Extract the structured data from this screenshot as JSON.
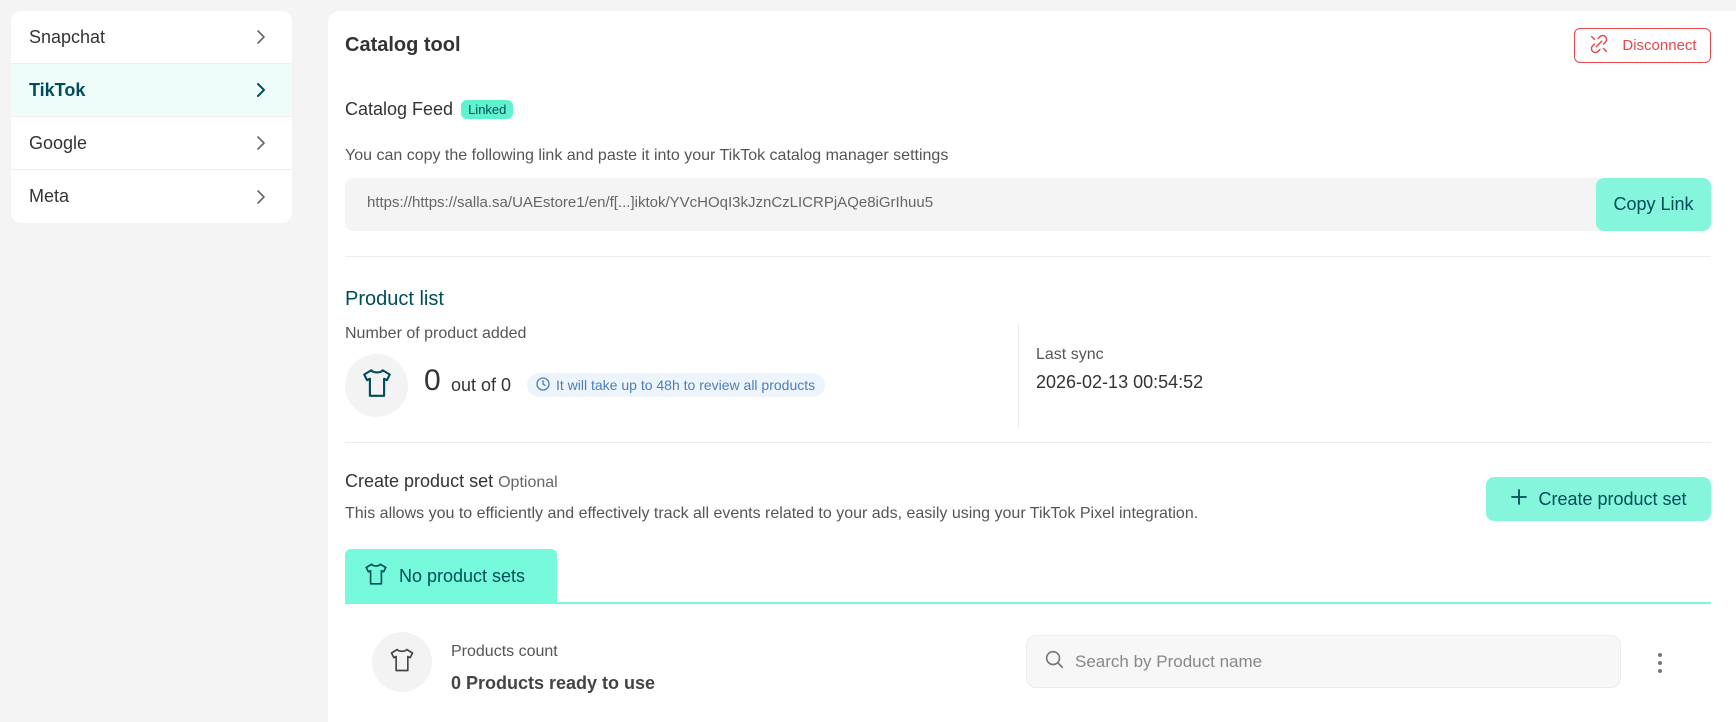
{
  "sidebar": {
    "items": [
      {
        "label": "Snapchat",
        "active": false
      },
      {
        "label": "TikTok",
        "active": true
      },
      {
        "label": "Google",
        "active": false
      },
      {
        "label": "Meta",
        "active": false
      }
    ]
  },
  "catalog": {
    "title": "Catalog tool",
    "disconnect_label": "Disconnect",
    "feed_title": "Catalog Feed",
    "feed_badge": "Linked",
    "feed_description": "You can copy the following link and paste it into your TikTok catalog manager settings",
    "feed_link": "https://https://salla.sa/UAEstore1/en/f[...]iktok/YVcHOqI3kJznCzLICRPjAQe8iGrIhuu5",
    "copy_label": "Copy Link"
  },
  "product_list": {
    "title": "Product list",
    "subtitle": "Number of product added",
    "count": "0",
    "count_of": "out of 0",
    "review_note": "It will take up to 48h to review all products",
    "last_sync_label": "Last sync",
    "last_sync_value": "2026-02-13 00:54:52"
  },
  "product_set": {
    "title": "Create product set",
    "optional": "Optional",
    "description": "This allows you to efficiently and effectively track all events related to your ads, easily using your TikTok Pixel integration.",
    "create_label": "Create product set",
    "tab_label": "No product sets",
    "count_label": "Products count",
    "count_value": "0 Products ready to use",
    "search_placeholder": "Search by Product name"
  },
  "colors": {
    "accent": "#85f5dc",
    "accent_dark": "#004d5a",
    "danger": "#e5484d",
    "info": "#4a7fb8"
  }
}
